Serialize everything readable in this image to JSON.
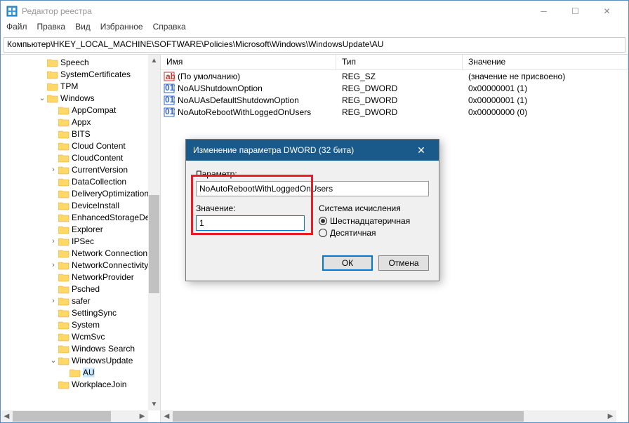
{
  "window": {
    "title": "Редактор реестра",
    "menu": [
      "Файл",
      "Правка",
      "Вид",
      "Избранное",
      "Справка"
    ],
    "address": "Компьютер\\HKEY_LOCAL_MACHINE\\SOFTWARE\\Policies\\Microsoft\\Windows\\WindowsUpdate\\AU"
  },
  "tree": [
    {
      "indent": 3,
      "exp": "",
      "label": "Speech"
    },
    {
      "indent": 3,
      "exp": "",
      "label": "SystemCertificates"
    },
    {
      "indent": 3,
      "exp": "",
      "label": "TPM"
    },
    {
      "indent": 3,
      "exp": "v",
      "label": "Windows"
    },
    {
      "indent": 4,
      "exp": "",
      "label": "AppCompat"
    },
    {
      "indent": 4,
      "exp": "",
      "label": "Appx"
    },
    {
      "indent": 4,
      "exp": "",
      "label": "BITS"
    },
    {
      "indent": 4,
      "exp": "",
      "label": "Cloud Content"
    },
    {
      "indent": 4,
      "exp": "",
      "label": "CloudContent"
    },
    {
      "indent": 4,
      "exp": ">",
      "label": "CurrentVersion"
    },
    {
      "indent": 4,
      "exp": "",
      "label": "DataCollection"
    },
    {
      "indent": 4,
      "exp": "",
      "label": "DeliveryOptimization"
    },
    {
      "indent": 4,
      "exp": "",
      "label": "DeviceInstall"
    },
    {
      "indent": 4,
      "exp": "",
      "label": "EnhancedStorageDev"
    },
    {
      "indent": 4,
      "exp": "",
      "label": "Explorer"
    },
    {
      "indent": 4,
      "exp": ">",
      "label": "IPSec"
    },
    {
      "indent": 4,
      "exp": "",
      "label": "Network Connection"
    },
    {
      "indent": 4,
      "exp": ">",
      "label": "NetworkConnectivity"
    },
    {
      "indent": 4,
      "exp": "",
      "label": "NetworkProvider"
    },
    {
      "indent": 4,
      "exp": "",
      "label": "Psched"
    },
    {
      "indent": 4,
      "exp": ">",
      "label": "safer"
    },
    {
      "indent": 4,
      "exp": "",
      "label": "SettingSync"
    },
    {
      "indent": 4,
      "exp": "",
      "label": "System"
    },
    {
      "indent": 4,
      "exp": "",
      "label": "WcmSvc"
    },
    {
      "indent": 4,
      "exp": "",
      "label": "Windows Search"
    },
    {
      "indent": 4,
      "exp": "v",
      "label": "WindowsUpdate"
    },
    {
      "indent": 5,
      "exp": "",
      "label": "AU",
      "selected": true
    },
    {
      "indent": 4,
      "exp": "",
      "label": "WorkplaceJoin"
    }
  ],
  "list": {
    "headers": {
      "name": "Имя",
      "type": "Тип",
      "value": "Значение"
    },
    "rows": [
      {
        "icon": "string",
        "name": "(По умолчанию)",
        "type": "REG_SZ",
        "value": "(значение не присвоено)"
      },
      {
        "icon": "dword",
        "name": "NoAUShutdownOption",
        "type": "REG_DWORD",
        "value": "0x00000001 (1)"
      },
      {
        "icon": "dword",
        "name": "NoAUAsDefaultShutdownOption",
        "type": "REG_DWORD",
        "value": "0x00000001 (1)"
      },
      {
        "icon": "dword",
        "name": "NoAutoRebootWithLoggedOnUsers",
        "type": "REG_DWORD",
        "value": "0x00000000 (0)"
      }
    ]
  },
  "dialog": {
    "title": "Изменение параметра DWORD (32 бита)",
    "param_label": "Параметр:",
    "param_value": "NoAutoRebootWithLoggedOnUsers",
    "value_label": "Значение:",
    "value_value": "1",
    "base_label": "Система исчисления",
    "radio_hex": "Шестнадцатеричная",
    "radio_dec": "Десятичная",
    "ok": "ОК",
    "cancel": "Отмена"
  }
}
